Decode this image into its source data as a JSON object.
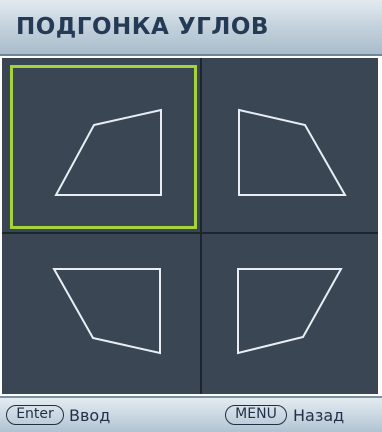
{
  "title": "ПОДГОНКА УГЛОВ",
  "corners": [
    {
      "id": "top-left",
      "selected": true
    },
    {
      "id": "top-right",
      "selected": false
    },
    {
      "id": "bottom-left",
      "selected": false
    },
    {
      "id": "bottom-right",
      "selected": false
    }
  ],
  "footer": {
    "enter_key": "Enter",
    "enter_label": "Ввод",
    "menu_key": "MENU",
    "menu_label": "Назад"
  },
  "colors": {
    "selection": "#a6d23a",
    "panel_bg": "#3b4654",
    "shape_stroke": "#e8eef3"
  }
}
